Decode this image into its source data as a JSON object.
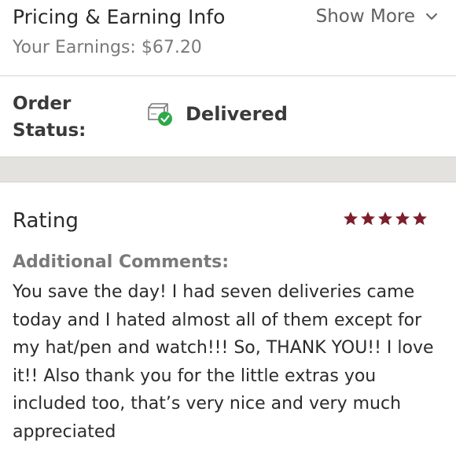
{
  "pricing": {
    "title": "Pricing & Earning Info",
    "show_more_label": "Show More",
    "earnings_text": "Your Earnings: $67.20"
  },
  "order": {
    "label": "Order Status:",
    "status": "Delivered",
    "status_icon": "delivered-box-check-icon",
    "status_icon_color": "#2ea84a"
  },
  "rating": {
    "label": "Rating",
    "stars": 5,
    "max_stars": 5,
    "star_color": "#7d1e2c"
  },
  "comments": {
    "heading": "Additional Comments:",
    "text": "You save the day! I had seven deliveries came today and I hated almost all of them except for my hat/pen and watch!!! So, THANK YOU!! I love it!! Also thank you for the little extras you included too, that’s very nice and very much appreciated"
  },
  "colors": {
    "divider_band": "#e4e2de",
    "muted_text": "#7a7a7a"
  }
}
